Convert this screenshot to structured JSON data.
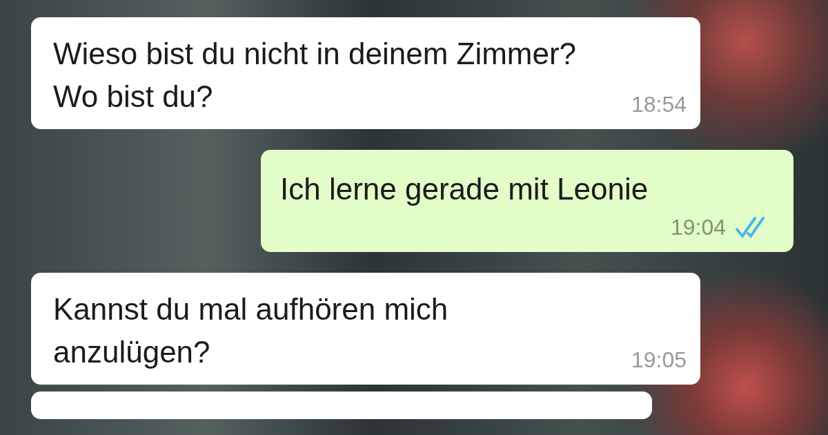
{
  "messages": [
    {
      "kind": "incoming",
      "text": "Wieso bist du nicht in deinem Zimmer? Wo bist du?",
      "time": "18:54"
    },
    {
      "kind": "outgoing",
      "text": "Ich lerne gerade mit Leonie",
      "time": "19:04",
      "read": true
    },
    {
      "kind": "incoming",
      "text": "Kannst du mal aufhören mich anzulügen?",
      "time": "19:05"
    }
  ]
}
